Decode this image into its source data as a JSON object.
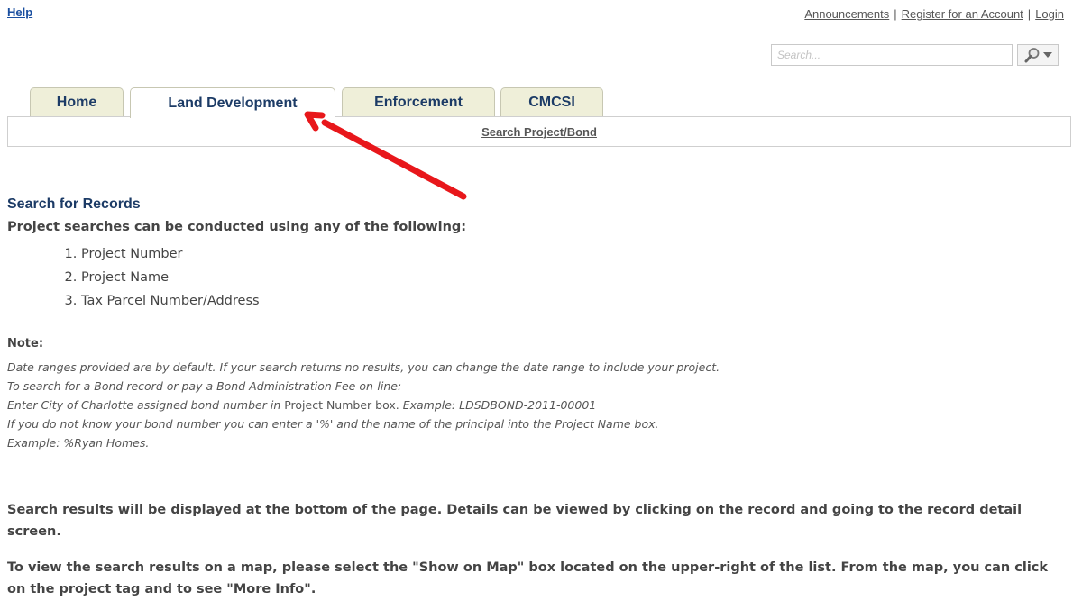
{
  "header": {
    "help_label": "Help",
    "links": [
      "Announcements",
      "Register for an Account",
      "Login"
    ],
    "separator": "|"
  },
  "search": {
    "placeholder": "Search...",
    "button_icon": "magnifier-icon",
    "dropdown_icon": "caret-down-icon"
  },
  "tabs": [
    {
      "label": "Home",
      "active": false
    },
    {
      "label": "Land Development",
      "active": true
    },
    {
      "label": "Enforcement",
      "active": false
    },
    {
      "label": "CMCSI",
      "active": false
    }
  ],
  "subnav": {
    "link_label": "Search Project/Bond"
  },
  "annotation": {
    "arrow_color": "#e8171b"
  },
  "content": {
    "section_title": "Search for Records",
    "intro": "Project searches can be conducted using any of the following:",
    "criteria": [
      "Project Number",
      "Project Name",
      "Tax Parcel Number/Address"
    ],
    "note_label": "Note:",
    "note_line1": "Date ranges provided are by default. If your search returns no results, you can change the date range to include your project.",
    "note_line2": "To search for a Bond record or pay a Bond Administration Fee on-line:",
    "note_line3_a": " Enter City of Charlotte assigned bond number in ",
    "note_line3_b": "Project Number box.",
    "note_line3_c": " Example: LDSDBOND-2011-00001",
    "note_line4": "If you do not know your bond number you can enter a '%' and the name of the principal into the Project Name box.",
    "note_line5": "Example: %Ryan Homes.",
    "results_text": "Search results will be displayed at the bottom of the page. Details can be viewed by clicking on the record and going to the record detail screen.",
    "map_text": "To view the search results on a map, please select the \"Show on Map\" box located on the upper-right of the list. From the map, you can click on the project tag and to see \"More Info\"."
  },
  "colors": {
    "tab_background": "#efefd9",
    "link_blue": "#1a4fa0",
    "heading_blue": "#1c3b66"
  }
}
